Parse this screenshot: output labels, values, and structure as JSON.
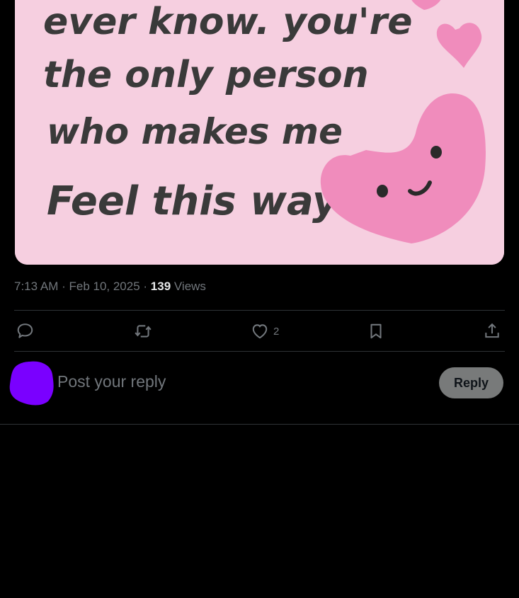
{
  "post": {
    "image": {
      "handwritten_lines": [
        "ever know. you're",
        "the only person",
        "who makes me",
        "Feel this way"
      ]
    },
    "meta": {
      "time": "7:13 AM",
      "sep1": " · ",
      "date": "Feb 10, 2025",
      "sep2": " · ",
      "views_count": "139",
      "views_label": " Views"
    },
    "actions": {
      "likes_count": "2"
    }
  },
  "reply": {
    "placeholder": "Post your reply",
    "button_label": "Reply"
  },
  "colors": {
    "avatar": "#7a00ff",
    "muted_text": "#71767b",
    "reply_button_bg": "#787a7a",
    "image_background": "#f6cfe0",
    "heart_pink": "#f08cbc"
  }
}
